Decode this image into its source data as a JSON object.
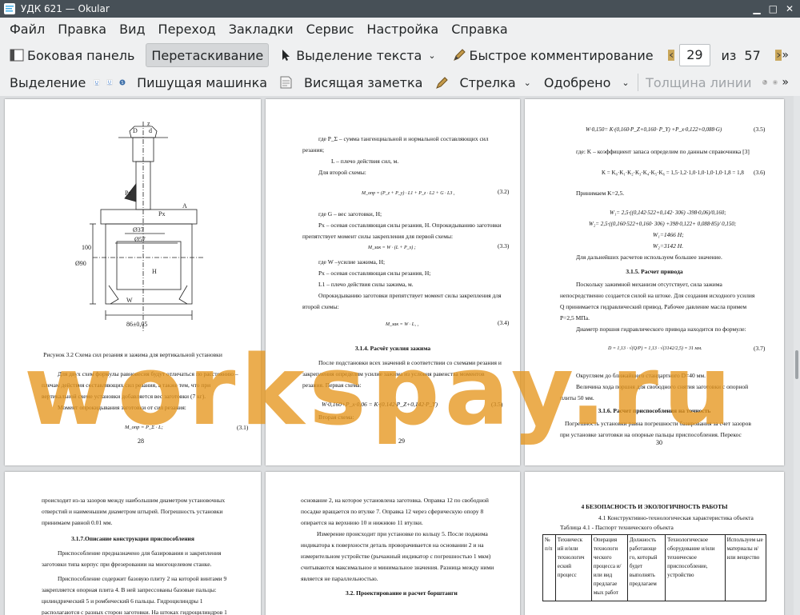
{
  "window": {
    "title": "УДК 621  — Okular"
  },
  "menu": [
    "Файл",
    "Правка",
    "Вид",
    "Переход",
    "Закладки",
    "Сервис",
    "Настройка",
    "Справка"
  ],
  "toolbar1": {
    "sidebar": "Боковая панель",
    "drag": "Перетаскивание",
    "text_select": "Выделение текста",
    "quick_comment": "Быстрое комментирование",
    "page_current": "29",
    "page_of": "из",
    "page_total": "57"
  },
  "toolbar2": {
    "highlight": "Выделение",
    "typewriter": "Пишущая машинка",
    "note": "Висящая заметка",
    "arrow": "Стрелка",
    "stamp": "Одобрено",
    "line_width": "Толщина линии"
  },
  "watermark": "workspay.ru",
  "pages": {
    "p28": {
      "fig_labels": [
        "D",
        "d",
        "z",
        "Рх",
        "Pz",
        "A",
        "W",
        "Ø37",
        "Ø57",
        "Ø90",
        "86±0,05",
        "100",
        "H"
      ],
      "caption": "Рисунок 3.2  Схема сил  резания и зажима для вертикальной установки",
      "lines": [
        "Для двух схем формулы равновесия будут отличаться по расстоянию –",
        "плечам  действия  составляющих  сил  резания,  а  также  тем,  что  при",
        "вертикальной схеме установки добавляется вес заготовки (7 кг).",
        "Момент опрокидывания заготовки от сил резания:"
      ],
      "formula": "M_опр = P_Σ · L;",
      "formula_no": "(3.1)",
      "number": "28"
    },
    "p29": {
      "lines": [
        "где     P_Σ  – сумма тангенциальной и нормальной составляющих сил",
        "резания;",
        "L – плечо действия сил, м.",
        "Для второй схемы:"
      ],
      "f1": "M_опр = (P_z + P_y) · L1 + P_z · L2 + G · L3 ,",
      "f1_no": "(3.2)",
      "lines2": [
        "где G – вес заготовки, Н;",
        "Pх – осевая составляющая силы резания, Н. Опрокидыванию заготовки",
        "препятствует момент силы закрепления для первой схемы:"
      ],
      "f2": "M_зак = W · (L + P_x) ;",
      "f2_no": "(3.3)",
      "lines3": [
        "где    W –усилие зажима, Н;",
        "Pх – осевая составляющая силы резания, Н;",
        "L1 – плечо действия силы зажима, м.",
        "Опрокидыванию заготовки препятствует момент силы закрепления для",
        "второй схемы:"
      ],
      "f3": "M_зак = W · L₁ ,",
      "f3_no": "(3.4)",
      "heading": "3.1.4. Расчёт усилия зажима",
      "lines4": [
        "После подстановки всех значений в соответствии со схемами резания и",
        "закрепления  определим  усилие  зажима  из  условия  равенства  моментов",
        "резания. Первая схема:"
      ],
      "f4": "W·0,160+P_x·0,06 = K·(0.142·P_Z+0,142·P_Y)",
      "f4_no": "(3.5)",
      "last": "Вторая схема:",
      "number": "29"
    },
    "p30": {
      "f1": "W·0,150= K·(0,160·P_Z+0,160· P_Y) +P_x·0,122+0,088·G)",
      "f1_no": "(3.5)",
      "l1": "где: K – коэффициент запаса определим по данным справочника [3]",
      "f2": "K = K₀·K₁·K₂·K₃·K₄·K₅·K₆ = 1,5·1,2·1,0·1,0·1,0·1,0·1,8 = 1,8",
      "f2_no": "(3.6)",
      "l2": "Принимаем K=2,5.",
      "eq": [
        "W₁= 2,5·((0,142·522+0,142· 306) -398·0,06)/0,160;",
        "W₂= 2,5·((0,160·522+0,160· 306) +398·0,122+ 0,088·85)/ 0,150;",
        "W₁=1466 Н;",
        "W₂=3142 Н."
      ],
      "l3": "Для дальнейших расчетов используем большее значение.",
      "heading": "3.1.5. Расчет привода",
      "lines": [
        "Поскольку    зажимной    механизм    отсутствует,    сила    зажима",
        "непосредственно создается силой на штоке. Для создания исходного усилия",
        "Q  принимается  гидравлический  привод.  Рабочее  давление  масла  примем",
        "P=2,5 МПа.",
        "Диаметр поршня гидравлического привода находится по формуле:"
      ],
      "f3": "D = 1,13 · √(Q/P) = 1,13 · √(3142/2,5) = 31 мм.",
      "f3_no": "(3.7)",
      "lines2": [
        "Округляем до ближайшего стандартного D=40 мм.",
        "Величина  хода  поршня  для  свободного  снятия  заготовки  с  опорной",
        "плиты 50 мм."
      ],
      "heading2": "3.1.6. Расчет приспособления на точность",
      "lines3": [
        "Погрешность  установки  равна  погрешности  базирования  за  счет  зазоров",
        "при   установке   заготовки   на   опорные   пальцы   приспособления.   Перекос"
      ],
      "number": "30"
    },
    "p31": {
      "lines": [
        "происходит  из-за  зазоров  между  наибольшим  диаметром  установочных",
        "отверстий  и  наименьшим  диаметром  штырей.  Погрешность  установки",
        "принимаем равной 0.01 мм."
      ],
      "heading": "3.1.7.Описание конструкции приспособления",
      "lines2": [
        "Приспособление   предназначено   для   базирования   и   закрепления",
        "заготовки типа корпус при фрезеровании на многоцелевом станке.",
        "Приспособление содержит базовую плиту 2 на которой винтами 9",
        "закрепляется  опорная  плита  4.  В  ней  запрессованы  базовые  пальцы:",
        "цилиндрический    5    и    ромбический    6    пальцы.    Гидроцилиндры    1",
        "располагаются  с  разных  сторон  заготовки.  На  штоках  гидроцилиндров  1"
      ]
    },
    "p32": {
      "lines": [
        "основание 2, на которое установлена заготовка. Оправка 12 по свободной",
        "посадке вращается по втулке 7. Оправка 12 через сферическую опору 8",
        "опирается на верхнюю 10 и нижнюю 11 втулки.",
        "Измерение  происходит  при  установке  по  кольцу  5.  После  поджима",
        "индикатора  к  поверхности  деталь  проворачивается  на  основании  2  и  на",
        "измерительном  устройстве  (рычажный  индикатор  с  погрешностью  1  мкм)",
        "считываются максимальное и минимальное значения. Разница между ними",
        "является не параллельностью."
      ],
      "heading": "3.2. Проектирование и расчет борштанги"
    },
    "p33": {
      "heading": "4 БЕЗОПАСНОСТЬ И ЭКОЛОГИЧНОСТЬ РАБОТЫ",
      "sub": "4.1 Конструктивно-технологическая характеристика объекта",
      "table_title": "Таблица 4.1 - Паспорт технического объекта",
      "table_headers": [
        "№ п/п",
        "Техническ ий  и/или технологич еский процесс",
        "Операция технологи ческого процесса и/или вид предлагае мых работ",
        "Должность работающе го, который будет выполнять предлагаем",
        "Технологическое оборудование и/или техническое приспособление, устройство",
        "Используем ые материалы и/или вещество"
      ]
    }
  }
}
